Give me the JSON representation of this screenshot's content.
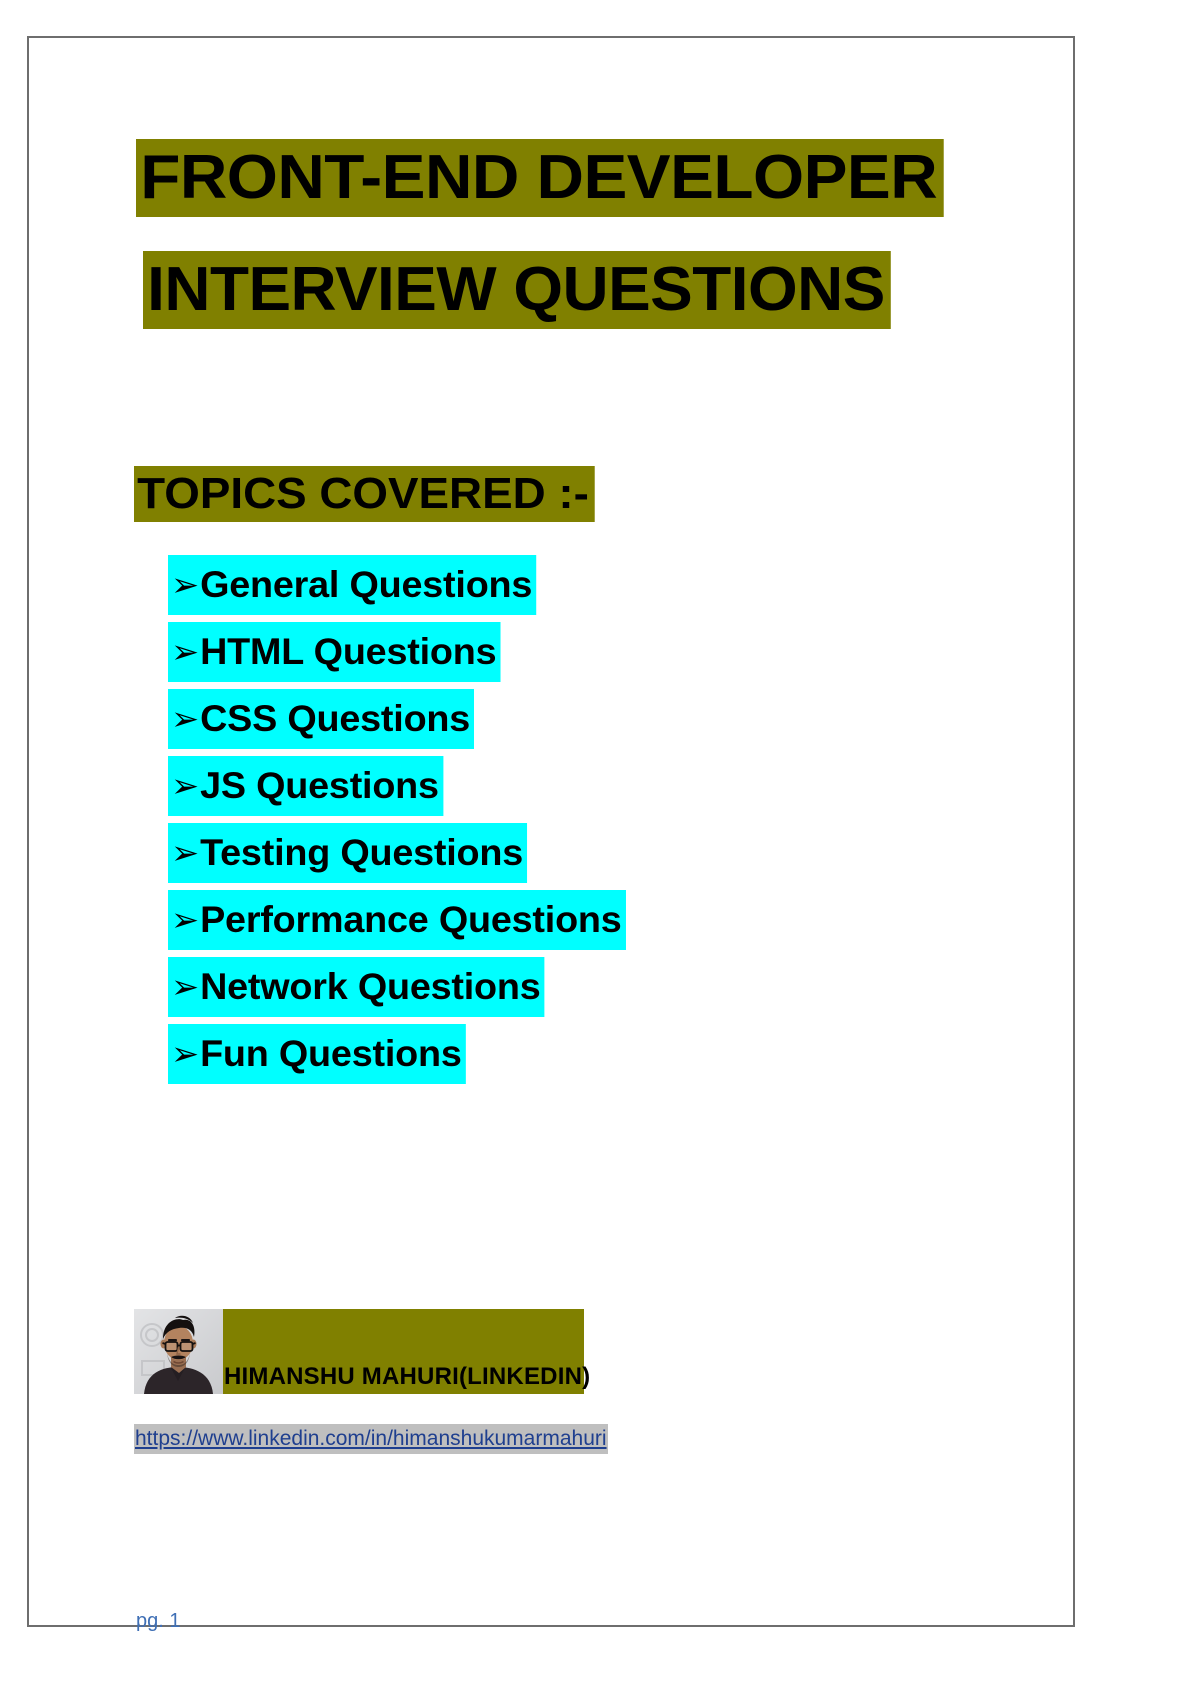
{
  "document": {
    "title_line_1": "FRONT-END DEVELOPER",
    "title_line_2": "INTERVIEW QUESTIONS",
    "topics_heading": "TOPICS COVERED :-"
  },
  "colors": {
    "highlight_heading": "#808000",
    "highlight_list": "#00ffff",
    "highlight_link": "#bfbfbf",
    "link_text": "#1f3f8f",
    "footer_text": "#3f6fb5",
    "page_border": "#6e6e6e"
  },
  "topics": {
    "bullet_glyph": "➢",
    "items": [
      {
        "label": "General Questions"
      },
      {
        "label": "HTML Questions"
      },
      {
        "label": "CSS Questions"
      },
      {
        "label": "JS Questions"
      },
      {
        "label": "Testing Questions"
      },
      {
        "label": "Performance Questions"
      },
      {
        "label": "Network Questions"
      },
      {
        "label": "Fun Questions"
      }
    ]
  },
  "author": {
    "name": "HIMANSHU MAHURI(LINKEDIN)",
    "photo_alt": "author-headshot",
    "link_text": "https://www.linkedin.com/in/himanshukumarmahuri"
  },
  "footer": {
    "page_label": "pg. 1"
  }
}
